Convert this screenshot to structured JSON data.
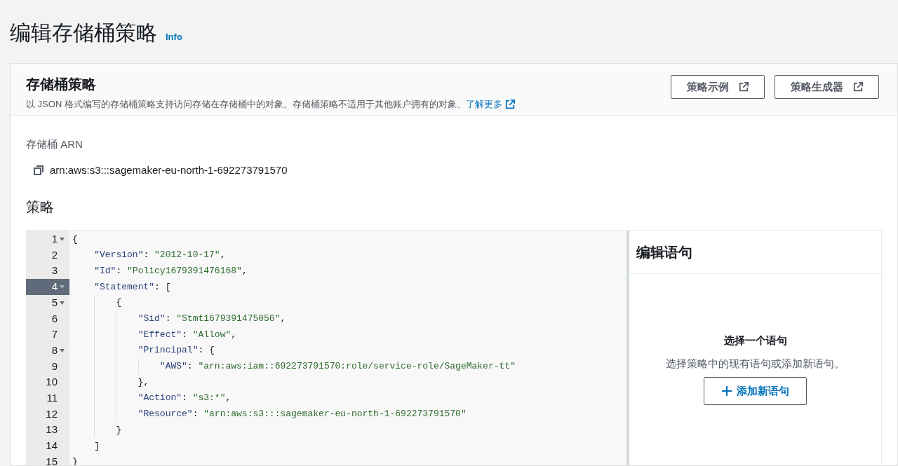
{
  "page_title": "编辑存储桶策略",
  "info_link": "Info",
  "card": {
    "title": "存储桶策略",
    "description": "以 JSON 格式编写的存储桶策略支持访问存储在存储桶中的对象。存储桶策略不适用于其他账户拥有的对象。",
    "learn_more_link": "了解更多",
    "buttons": [
      "策略示例",
      "策略生成器"
    ],
    "arn_label": "存储桶 ARN",
    "arn_value": "arn:aws:s3:::sagemaker-eu-north-1-692273791570",
    "policy_label": "策略",
    "editor": {
      "lines": [
        {
          "number": "1",
          "foldable": true,
          "selected": false,
          "text": "{"
        },
        {
          "number": "2",
          "foldable": false,
          "selected": false,
          "text": "    \"Version\": \"2012-10-17\","
        },
        {
          "number": "3",
          "foldable": false,
          "selected": false,
          "text": "    \"Id\": \"Policy1679391476168\","
        },
        {
          "number": "4",
          "foldable": true,
          "selected": true,
          "text": "    \"Statement\": ["
        },
        {
          "number": "5",
          "foldable": true,
          "selected": false,
          "text": "        {"
        },
        {
          "number": "6",
          "foldable": false,
          "selected": false,
          "text": "            \"Sid\": \"Stmt1679391475056\","
        },
        {
          "number": "7",
          "foldable": false,
          "selected": false,
          "text": "            \"Effect\": \"Allow\","
        },
        {
          "number": "8",
          "foldable": true,
          "selected": false,
          "text": "            \"Principal\": {"
        },
        {
          "number": "9",
          "foldable": false,
          "selected": false,
          "text": "                \"AWS\": \"arn:aws:iam::692273791570:role/service-role/SageMaker-tt\""
        },
        {
          "number": "10",
          "foldable": false,
          "selected": false,
          "text": "            },"
        },
        {
          "number": "11",
          "foldable": false,
          "selected": false,
          "text": "            \"Action\": \"s3:*\","
        },
        {
          "number": "12",
          "foldable": false,
          "selected": false,
          "text": "            \"Resource\": \"arn:aws:s3:::sagemaker-eu-north-1-692273791570\""
        },
        {
          "number": "13",
          "foldable": false,
          "selected": false,
          "text": "        }"
        },
        {
          "number": "14",
          "foldable": false,
          "selected": false,
          "text": "    ]"
        },
        {
          "number": "15",
          "foldable": false,
          "selected": false,
          "text": "}"
        }
      ]
    },
    "statement_panel": {
      "title": "编辑语句",
      "empty_title": "选择一个语句",
      "empty_text": "选择策略中的现有语句或添加新语句。",
      "add_button": "添加新语句"
    }
  }
}
